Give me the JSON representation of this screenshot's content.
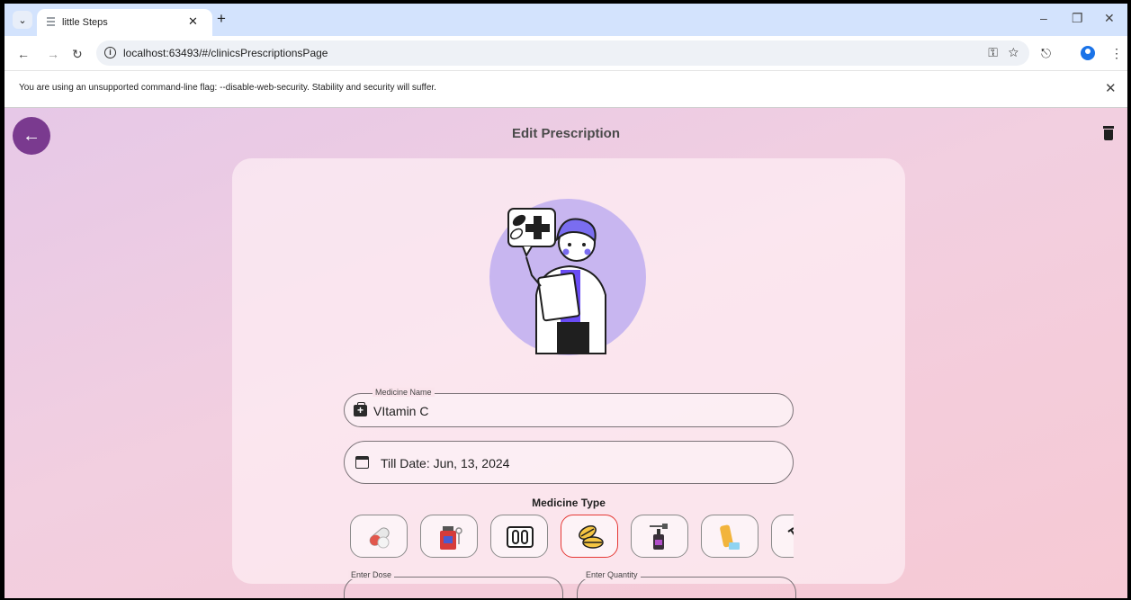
{
  "browser": {
    "tab_title": "little Steps",
    "url": "localhost:63493/#/clinicsPrescriptionsPage",
    "infobar_text": "You are using an unsupported command-line flag: --disable-web-security. Stability and security will suffer."
  },
  "app": {
    "page_title": "Edit Prescription",
    "medicine_name": {
      "label": "Medicine Name",
      "value": "VItamin C"
    },
    "till_date": {
      "value": "Till Date: Jun, 13, 2024"
    },
    "medicine_type_title": "Medicine Type",
    "medicine_types": [
      {
        "icon": "capsules-icon",
        "selected": false
      },
      {
        "icon": "syrup-bottle-icon",
        "selected": false
      },
      {
        "icon": "ampoules-icon",
        "selected": false
      },
      {
        "icon": "tablets-icon",
        "selected": true
      },
      {
        "icon": "dropper-bottle-icon",
        "selected": false
      },
      {
        "icon": "inhaler-icon",
        "selected": false
      },
      {
        "icon": "syringe-icon",
        "selected": false
      }
    ],
    "dose": {
      "label": "Enter Dose"
    },
    "quantity": {
      "label": "Enter Quantity"
    },
    "colors": {
      "accent": "#7a3a8f",
      "selected_border": "#e53935"
    }
  }
}
